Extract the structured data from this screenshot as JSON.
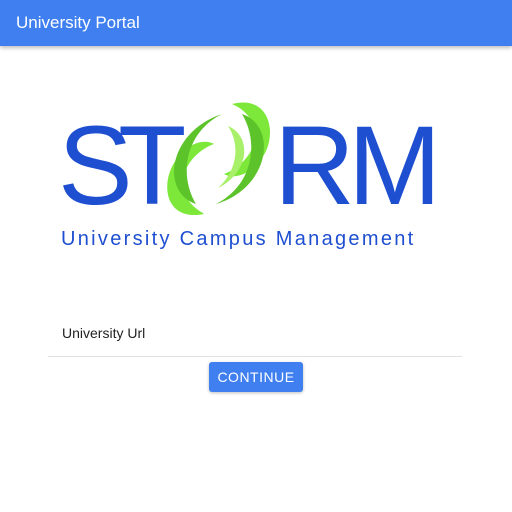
{
  "app_bar": {
    "title": "University Portal",
    "color": "#3f7ff0"
  },
  "logo": {
    "wordmark": "STORM",
    "tagline": "University Campus Management",
    "brand_color": "#1f4fd1",
    "swirl_color": "#7de83a"
  },
  "form": {
    "url_placeholder": "University Url",
    "url_value": "",
    "continue_label": "CONTINUE"
  }
}
